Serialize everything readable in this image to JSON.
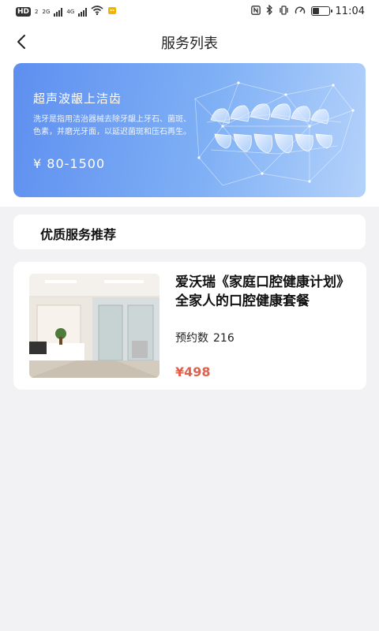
{
  "status_bar": {
    "hd_label": "HD",
    "sim_number": "2",
    "net_left": "2G",
    "net_right": "4G",
    "time": "11:04",
    "battery_level": 0.4
  },
  "header": {
    "title": "服务列表",
    "back_icon": "back-arrow-icon"
  },
  "banner": {
    "title": "超声波龈上洁齿",
    "description": "洗牙是指用洁治器械去除牙龈上牙石、菌斑、色素，并磨光牙面，以延迟菌斑和压石再生。",
    "price": "¥ 80-1500"
  },
  "section": {
    "title": "优质服务推荐"
  },
  "services": [
    {
      "title": "爱沃瑞《家庭口腔健康计划》全家人的口腔健康套餐",
      "count_label": "预约数",
      "count_value": "216",
      "price": "¥498"
    }
  ],
  "colors": {
    "accent_price": "#e0604e",
    "banner_start": "#5e8ff0",
    "banner_end": "#b4d2fb",
    "background": "#f2f2f4"
  }
}
